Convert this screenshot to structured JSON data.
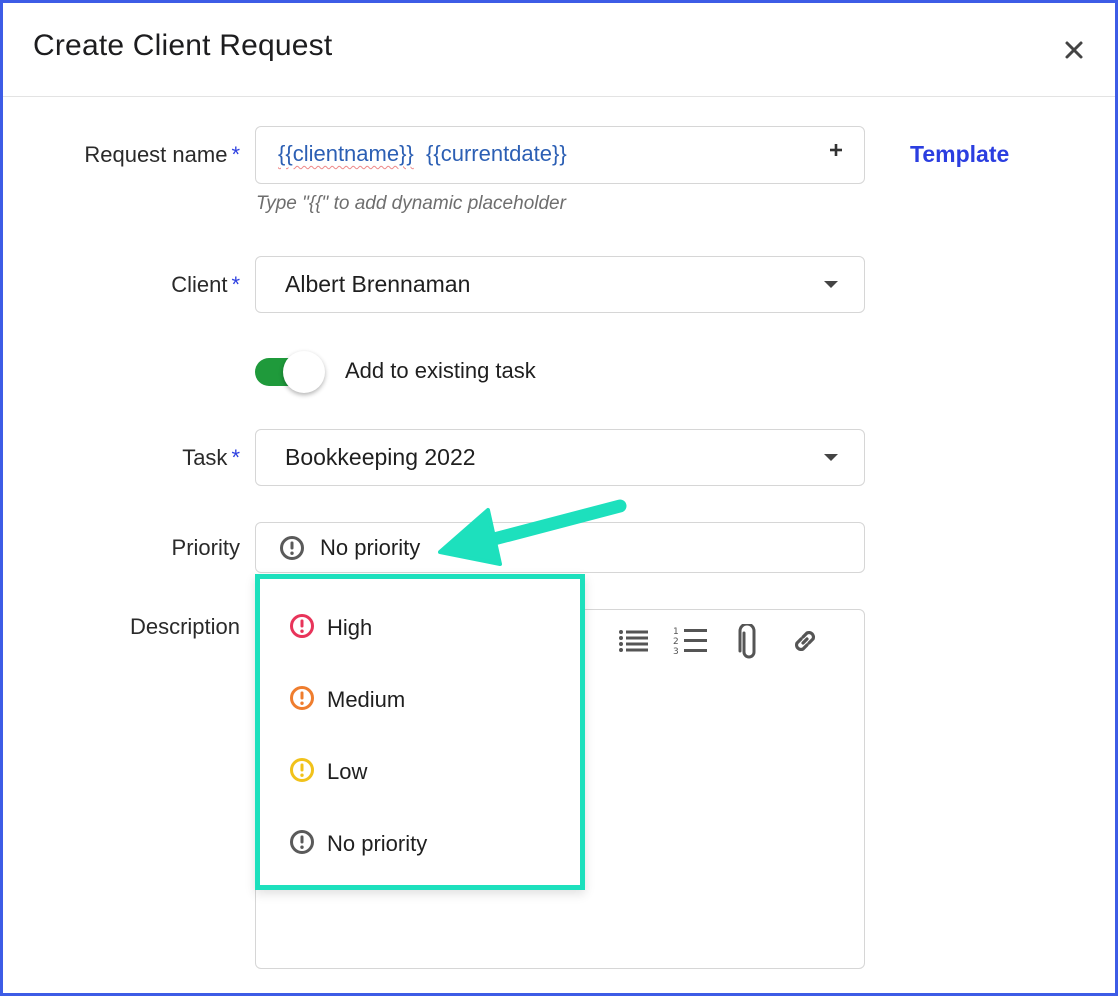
{
  "dialog": {
    "title": "Create Client Request"
  },
  "form": {
    "request_name": {
      "label": "Request name",
      "required_mark": "*",
      "token_1": "{{clientname}}",
      "token_2": "{{currentdate}}",
      "hint": "Type \"{{\" to add dynamic placeholder"
    },
    "template_link": "Template",
    "client": {
      "label": "Client",
      "required_mark": "*",
      "value": "Albert Brennaman"
    },
    "toggle": {
      "label": "Add to existing task",
      "on": true
    },
    "task": {
      "label": "Task",
      "required_mark": "*",
      "value": "Bookkeeping 2022"
    },
    "priority": {
      "label": "Priority",
      "value": "No priority"
    },
    "description": {
      "label": "Description"
    }
  },
  "priority_menu": {
    "options": [
      {
        "label": "High",
        "color": "#e8345a"
      },
      {
        "label": "Medium",
        "color": "#ef7d2e"
      },
      {
        "label": "Low",
        "color": "#f1c21b"
      },
      {
        "label": "No priority",
        "color": "#5a5a5a"
      }
    ]
  },
  "colors": {
    "accent": "#2b3ee0",
    "toggle_on": "#1f9a3b",
    "highlight": "#1de0bd",
    "frame": "#3d5ce6"
  },
  "icons": {
    "close": "close-icon",
    "plus": "plus-icon",
    "caret": "chevron-down-icon",
    "bullet_list": "bulleted-list-icon",
    "numbered_list": "numbered-list-icon",
    "attachment": "paperclip-icon",
    "link": "link-icon",
    "priority": "priority-alert-icon"
  }
}
